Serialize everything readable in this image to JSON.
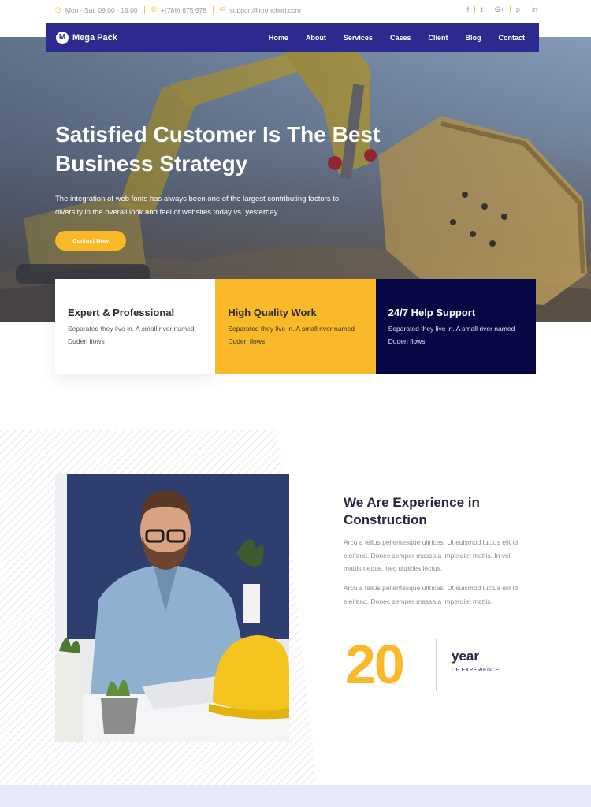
{
  "topbar": {
    "hours": "Mon - Sat: 09.00 - 19.00",
    "phone": "+(789) 675 978",
    "email": "support@monchori.com",
    "social": [
      "f",
      "t",
      "G+",
      "p",
      "in"
    ]
  },
  "navbar": {
    "logo_mark": "M",
    "logo_text": "Mega Pack",
    "menu": [
      "Home",
      "About",
      "Services",
      "Cases",
      "Client",
      "Blog",
      "Contact"
    ]
  },
  "hero": {
    "title": "Satisfied Customer Is The Best Business Strategy",
    "text": "The integration of web fonts has always been one of the largest contributing factors to diversity in the overall look and feel of websites today vs. yesterday.",
    "button": "Contact Now"
  },
  "features": [
    {
      "title": "Expert & Professional",
      "text": "Separated they live in. A small river named Duden flows"
    },
    {
      "title": "High Quality Work",
      "text": "Separated they live in. A small river named Duden flows"
    },
    {
      "title": "24/7 Help Support",
      "text": "Separated they live in. A small river named Duden flows"
    }
  ],
  "about": {
    "title": "We Are Experience in Construction",
    "p1": "Arcu a tellus pellentesque ultrices. Ut euismod luctus elit id eleifend. Donec semper massa a imperdiet mattis. In vel mattis neque, nec ultricies lectus.",
    "p2": "Arcu a tellus pellentesque ultrices. Ut euismod luctus elit id eleifend. Donec semper massa a imperdiet mattis.",
    "stat_number": "20",
    "stat_label": "year",
    "stat_sub": "OF EXPERIENCE"
  },
  "colors": {
    "brand_navy": "#2d2a8f",
    "accent_yellow": "#f9b928",
    "dark_navy": "#080746"
  },
  "icons": [
    "clock-icon",
    "phone-icon",
    "envelope-icon",
    "facebook-icon",
    "twitter-icon",
    "google-plus-icon",
    "pinterest-icon",
    "linkedin-icon"
  ]
}
